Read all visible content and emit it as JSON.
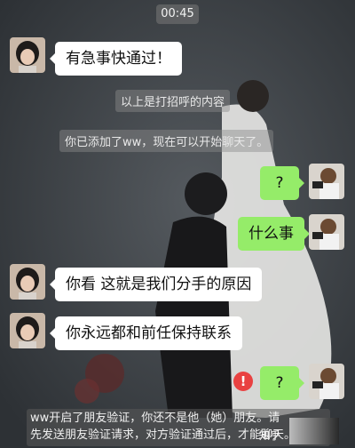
{
  "status": {
    "time": "00:45"
  },
  "messages": [
    {
      "side": "in",
      "text": "有急事快通过！"
    },
    {
      "side": "system",
      "text": "以上是打招呼的内容"
    },
    {
      "side": "system",
      "text": "你已添加了ww，现在可以开始聊天了。"
    },
    {
      "side": "out",
      "text": "?"
    },
    {
      "side": "out",
      "text": "什么事"
    },
    {
      "side": "in",
      "text": "你看 这就是我们分手的原因"
    },
    {
      "side": "in",
      "text": "你永远都和前任保持联系"
    },
    {
      "side": "out",
      "text": "?",
      "failed": true
    }
  ],
  "failed_icon": "exclamation-icon",
  "verification_notice": {
    "line1": "ww开启了朋友验证，你还不是他（她）朋友。请",
    "line2": "先发送朋友验证请求，对方验证通过后，才能聊天。"
  },
  "watermark": "知乎",
  "colors": {
    "outgoing_bubble": "#95ec69",
    "incoming_bubble": "#ffffff",
    "error": "#e94141"
  }
}
